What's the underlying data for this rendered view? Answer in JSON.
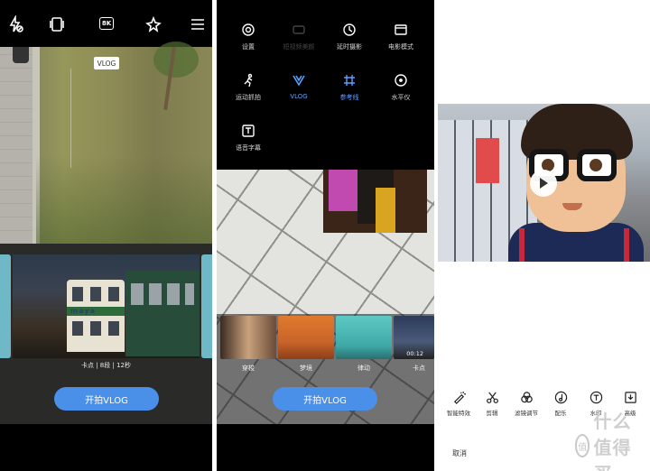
{
  "screen1": {
    "viewfinder_tag": "VLOG",
    "quality_badge": "8K",
    "topbar_icons": [
      "flash-off-icon",
      "aspect-ratio-icon",
      "resolution-8k-icon",
      "ai-beauty-icon",
      "menu-icon"
    ],
    "template_caption": "卡点 | 8段 | 12秒",
    "tram_text": "maya",
    "start_button": "开拍VLOG"
  },
  "screen2": {
    "menu": [
      {
        "label": "设置",
        "icon": "settings-icon",
        "state": "normal"
      },
      {
        "label": "短视频美颜",
        "icon": "beauty-icon",
        "state": "disabled"
      },
      {
        "label": "延时摄影",
        "icon": "timelapse-icon",
        "state": "normal"
      },
      {
        "label": "电影模式",
        "icon": "movie-mode-icon",
        "state": "normal"
      },
      {
        "label": "运动抓拍",
        "icon": "motion-capture-icon",
        "state": "normal"
      },
      {
        "label": "VLOG",
        "icon": "vlog-icon",
        "state": "active"
      },
      {
        "label": "参考线",
        "icon": "grid-icon",
        "state": "active"
      },
      {
        "label": "水平仪",
        "icon": "level-icon",
        "state": "normal"
      },
      {
        "label": "语音字幕",
        "icon": "voice-subtitle-icon",
        "state": "normal"
      }
    ],
    "templates": [
      {
        "label": "穿梭"
      },
      {
        "label": "梦境"
      },
      {
        "label": "律动"
      },
      {
        "label": "卡点",
        "time": "00:12"
      }
    ],
    "start_button": "开拍VLOG"
  },
  "screen3": {
    "tools": [
      {
        "label": "智能特效",
        "icon": "smart-effects-icon"
      },
      {
        "label": "剪辑",
        "icon": "scissors-icon"
      },
      {
        "label": "滤镜调节",
        "icon": "filter-icon"
      },
      {
        "label": "配乐",
        "icon": "music-icon"
      },
      {
        "label": "水印",
        "icon": "watermark-icon"
      },
      {
        "label": "高级",
        "icon": "advanced-icon"
      }
    ],
    "cancel": "取消",
    "watermark_badge": "值",
    "watermark_text": "什么值得买"
  },
  "colors": {
    "accent": "#4a90e8",
    "active": "#5aa0ff"
  }
}
